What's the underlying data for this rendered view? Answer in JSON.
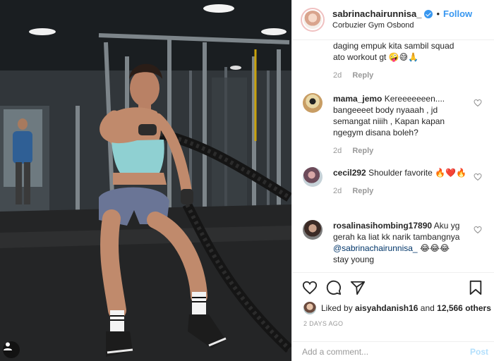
{
  "post": {
    "author": "sabrinachairunnisa_",
    "separator": "•",
    "follow_label": "Follow",
    "location": "Corbuzier Gym Osbond"
  },
  "comments": [
    {
      "username": "",
      "text": "daging empuk kita sambil squad ato workout gt 🤪😅🙏",
      "age": "2d",
      "reply": "Reply"
    },
    {
      "username": "mama_jemo",
      "text": "Kereeeeeeen.... bangeeeet body nyaaah , jd semangat niiih , Kapan kapan ngegym disana boleh?",
      "age": "2d",
      "reply": "Reply"
    },
    {
      "username": "cecil292",
      "text": "Shoulder favorite 🔥❤️🔥",
      "age": "2d",
      "reply": "Reply"
    },
    {
      "username": "rosalinasihombing17890",
      "text": "Aku yg gerah ka liat kk narik tambangnya",
      "mention": "@sabrinachairunnisa_",
      "tail": "😂😂😂 stay young"
    }
  ],
  "likes": {
    "prefix": "Liked by",
    "user": "aisyahdanish16",
    "joiner": "and",
    "others": "12,566 others"
  },
  "time_ago": "2 DAYS AGO",
  "add_comment": {
    "placeholder": "Add a comment...",
    "post_label": "Post"
  },
  "colors": {
    "accent": "#3897f0",
    "meta_gray": "#999999",
    "post_disabled": "#b2dffc",
    "heart_red": "#ed4956"
  },
  "icons": [
    "tag-user-icon",
    "verified-badge-icon",
    "heart-icon",
    "comment-icon",
    "share-icon",
    "bookmark-icon"
  ]
}
